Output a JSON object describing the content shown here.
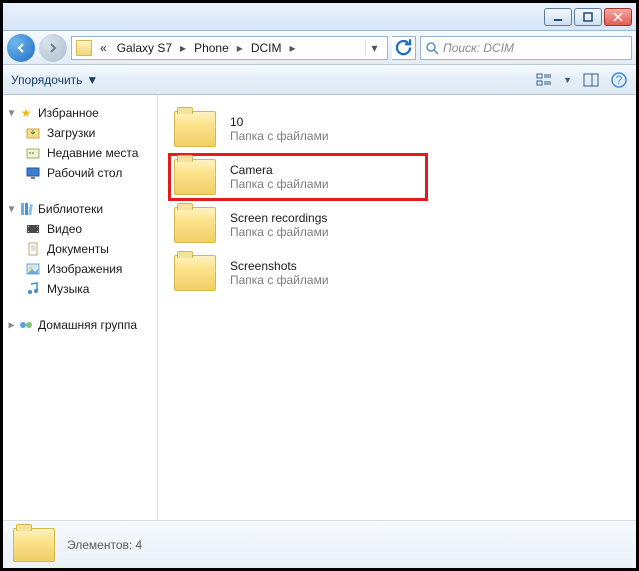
{
  "titlebar": {},
  "nav": {
    "crumbs": [
      "Galaxy S7",
      "Phone",
      "DCIM"
    ],
    "crumb_prefix": "«",
    "search_placeholder": "Поиск: DCIM"
  },
  "toolbar": {
    "organize": "Упорядочить"
  },
  "sidebar": {
    "favorites": {
      "label": "Избранное",
      "items": [
        {
          "label": "Загрузки",
          "icon": "download-icon"
        },
        {
          "label": "Недавние места",
          "icon": "recent-icon"
        },
        {
          "label": "Рабочий стол",
          "icon": "desktop-icon"
        }
      ]
    },
    "libraries": {
      "label": "Библиотеки",
      "items": [
        {
          "label": "Видео",
          "icon": "video-icon"
        },
        {
          "label": "Документы",
          "icon": "documents-icon"
        },
        {
          "label": "Изображения",
          "icon": "pictures-icon"
        },
        {
          "label": "Музыка",
          "icon": "music-icon"
        }
      ]
    },
    "homegroup": {
      "label": "Домашняя группа"
    }
  },
  "content": {
    "type_label": "Папка с файлами",
    "items": [
      {
        "name": "10",
        "highlight": false
      },
      {
        "name": "Camera",
        "highlight": true
      },
      {
        "name": "Screen recordings",
        "highlight": false
      },
      {
        "name": "Screenshots",
        "highlight": false
      }
    ]
  },
  "status": {
    "text": "Элементов: 4"
  }
}
